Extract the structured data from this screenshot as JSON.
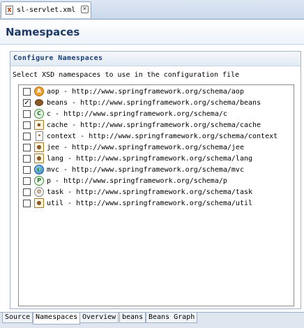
{
  "editor_tab": {
    "title": "sl-servlet.xml",
    "file_icon": "xml-file-icon",
    "close_icon": "close-icon"
  },
  "page": {
    "title": "Namespaces"
  },
  "section": {
    "title": "Configure Namespaces",
    "description": "Select XSD namespaces to use in the configuration file"
  },
  "namespaces": [
    {
      "label": "aop - http://www.springframework.org/schema/aop",
      "checked": false,
      "icon": "aop-icon"
    },
    {
      "label": "beans - http://www.springframework.org/schema/beans",
      "checked": true,
      "icon": "bean-icon"
    },
    {
      "label": "c - http://www.springframework.org/schema/c",
      "checked": false,
      "icon": "c-namespace-icon"
    },
    {
      "label": "cache - http://www.springframework.org/schema/cache",
      "checked": false,
      "icon": "cache-icon"
    },
    {
      "label": "context - http://www.springframework.org/schema/context",
      "checked": false,
      "icon": "context-icon"
    },
    {
      "label": "jee - http://www.springframework.org/schema/jee",
      "checked": false,
      "icon": "jee-icon"
    },
    {
      "label": "lang - http://www.springframework.org/schema/lang",
      "checked": false,
      "icon": "lang-icon"
    },
    {
      "label": "mvc - http://www.springframework.org/schema/mvc",
      "checked": false,
      "icon": "mvc-globe-icon"
    },
    {
      "label": "p - http://www.springframework.org/schema/p",
      "checked": false,
      "icon": "p-namespace-icon"
    },
    {
      "label": "task - http://www.springframework.org/schema/task",
      "checked": false,
      "icon": "task-icon"
    },
    {
      "label": "util - http://www.springframework.org/schema/util",
      "checked": false,
      "icon": "util-icon"
    }
  ],
  "bottom_tabs": [
    {
      "label": "Source",
      "active": false
    },
    {
      "label": "Namespaces",
      "active": true
    },
    {
      "label": "Overview",
      "active": false
    },
    {
      "label": "beans",
      "active": false
    },
    {
      "label": "Beans Graph",
      "active": false
    }
  ]
}
